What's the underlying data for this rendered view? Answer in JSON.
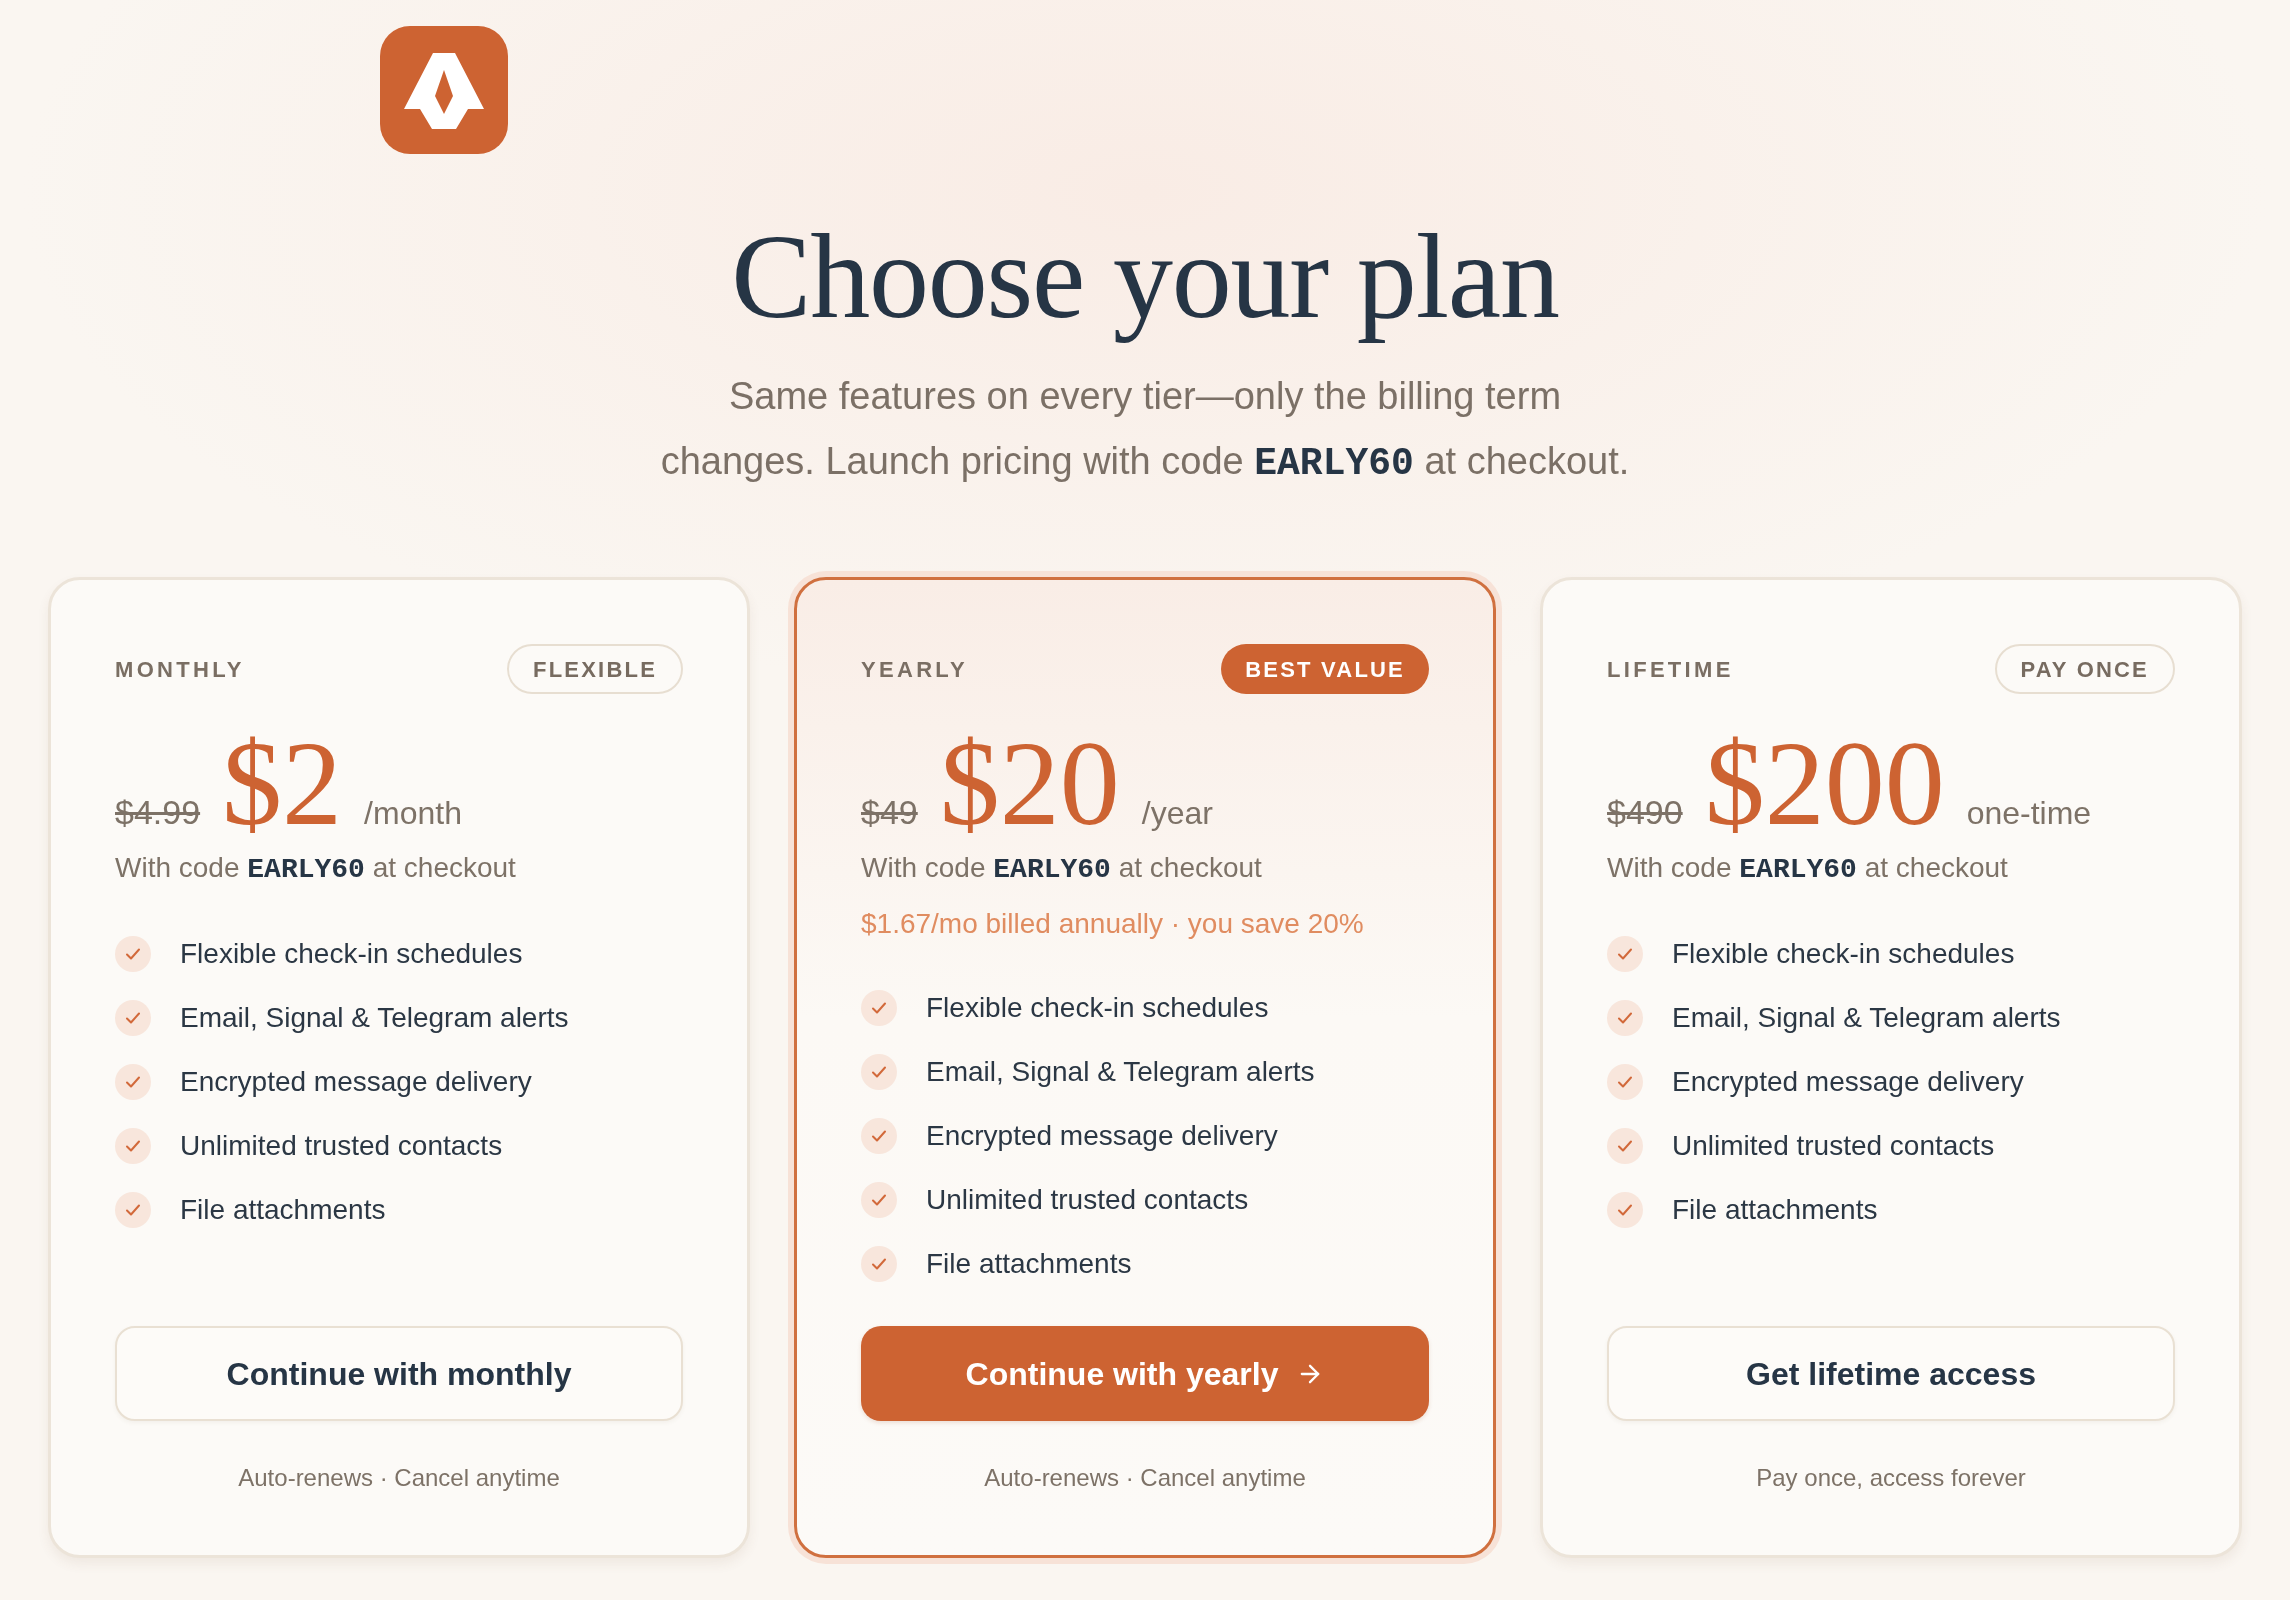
{
  "heading": "Choose your plan",
  "subtitle": "Same features on every tier—only the billing term changes. Launch pricing with code **EARLY60** at checkout.",
  "plans": [
    {
      "name": "MONTHLY",
      "badge": "FLEXIBLE",
      "featured": false,
      "original_price": "$4.99",
      "price": "$2",
      "period": "/month",
      "code_note": "With code **EARLY60** at checkout",
      "features": [
        "Flexible check-in schedules",
        "Email, Signal & Telegram alerts",
        "Encrypted message delivery",
        "Unlimited trusted contacts",
        "File attachments"
      ],
      "button": "Continue with monthly",
      "footnote": "Auto-renews · Cancel anytime"
    },
    {
      "name": "YEARLY",
      "badge": "BEST VALUE",
      "featured": true,
      "original_price": "$49",
      "price": "$20",
      "period": "/year",
      "code_note": "With code **EARLY60** at checkout",
      "savings_note": "$1.67/mo billed annually · you save 20%",
      "features": [
        "Flexible check-in schedules",
        "Email, Signal & Telegram alerts",
        "Encrypted message delivery",
        "Unlimited trusted contacts",
        "File attachments"
      ],
      "button": "Continue with yearly",
      "footnote": "Auto-renews · Cancel anytime"
    },
    {
      "name": "LIFETIME",
      "badge": "PAY ONCE",
      "featured": false,
      "original_price": "$490",
      "price": "$200",
      "period": "one-time",
      "code_note": "With code **EARLY60** at checkout",
      "features": [
        "Flexible check-in schedules",
        "Email, Signal & Telegram alerts",
        "Encrypted message delivery",
        "Unlimited trusted contacts",
        "File attachments"
      ],
      "button": "Get lifetime access",
      "footnote": "Pay once, access forever"
    }
  ]
}
